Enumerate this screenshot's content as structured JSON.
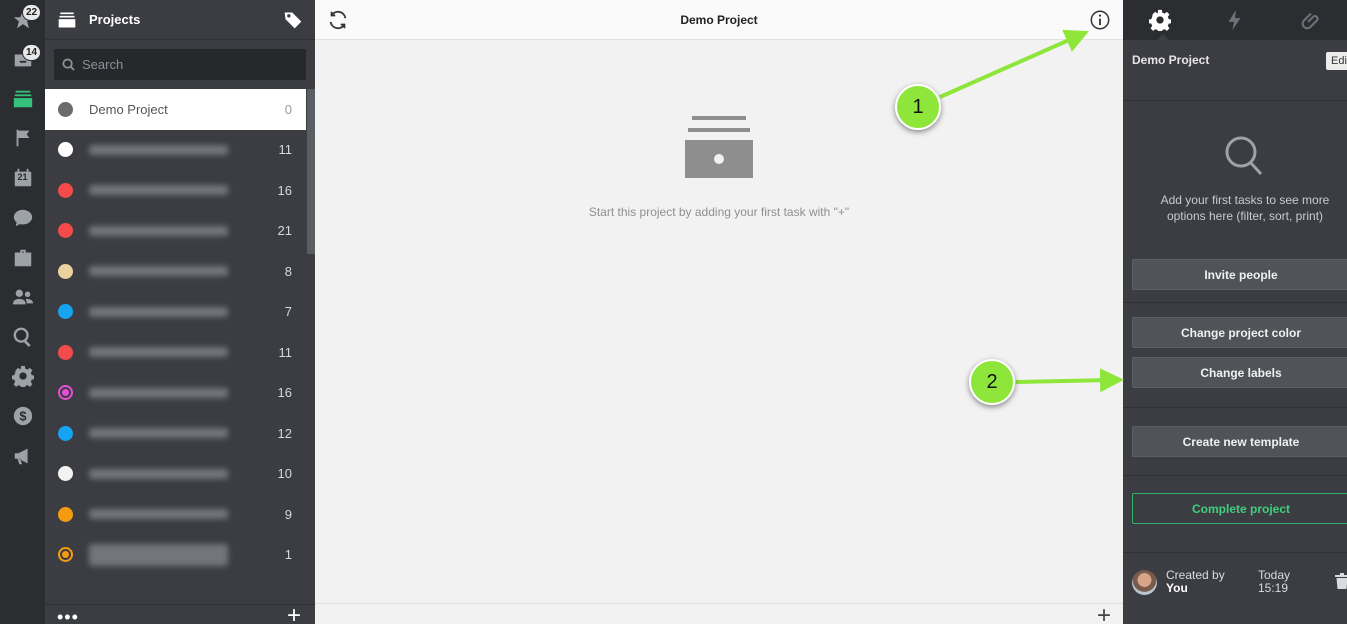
{
  "rail": {
    "starred_badge": "22",
    "inbox_badge": "14",
    "calendar_day": "21"
  },
  "projects_panel": {
    "title": "Projects",
    "search_placeholder": "Search",
    "items": [
      {
        "name": "Demo Project",
        "count": "0",
        "color": "#6b6b6b",
        "active": true,
        "blurred": false
      },
      {
        "name": "",
        "count": "11",
        "color": "#ffffff",
        "active": false,
        "blurred": true
      },
      {
        "name": "",
        "count": "16",
        "color": "#f24b4b",
        "active": false,
        "blurred": true
      },
      {
        "name": "",
        "count": "21",
        "color": "#f24b4b",
        "active": false,
        "blurred": true
      },
      {
        "name": "",
        "count": "8",
        "color": "#ead29f",
        "active": false,
        "blurred": true
      },
      {
        "name": "",
        "count": "7",
        "color": "#16a3f0",
        "active": false,
        "blurred": true
      },
      {
        "name": "",
        "count": "11",
        "color": "#f24b4b",
        "active": false,
        "blurred": true
      },
      {
        "name": "",
        "count": "16",
        "color": "#e54fd6",
        "active": false,
        "blurred": true,
        "ring": true
      },
      {
        "name": "",
        "count": "12",
        "color": "#16a3f0",
        "active": false,
        "blurred": true
      },
      {
        "name": "",
        "count": "10",
        "color": "#f2f2f2",
        "active": false,
        "blurred": true
      },
      {
        "name": "",
        "count": "9",
        "color": "#f59b12",
        "active": false,
        "blurred": true
      },
      {
        "name": "",
        "count": "1",
        "color": "#f59b12",
        "active": false,
        "blurred": true,
        "ring": true
      }
    ],
    "footer_more": "•••",
    "footer_add": "+"
  },
  "main": {
    "title": "Demo Project",
    "empty_message": "Start this project by adding your first task with \"+\"",
    "add_symbol": "+"
  },
  "info_panel": {
    "project_name": "Demo Project",
    "edit_label": "Edit",
    "hint": "Add your first tasks to see more options here (filter, sort, print)",
    "invite_button": "Invite people",
    "change_color_button": "Change project color",
    "change_labels_button": "Change labels",
    "create_template_button": "Create new template",
    "complete_button": "Complete project",
    "created_by_label": "Created by",
    "created_by_user": "You",
    "created_day": "Today",
    "created_time": "15:19"
  },
  "annotations": {
    "callout_1": "1",
    "callout_2": "2",
    "arrow_color": "#8ee63a"
  }
}
